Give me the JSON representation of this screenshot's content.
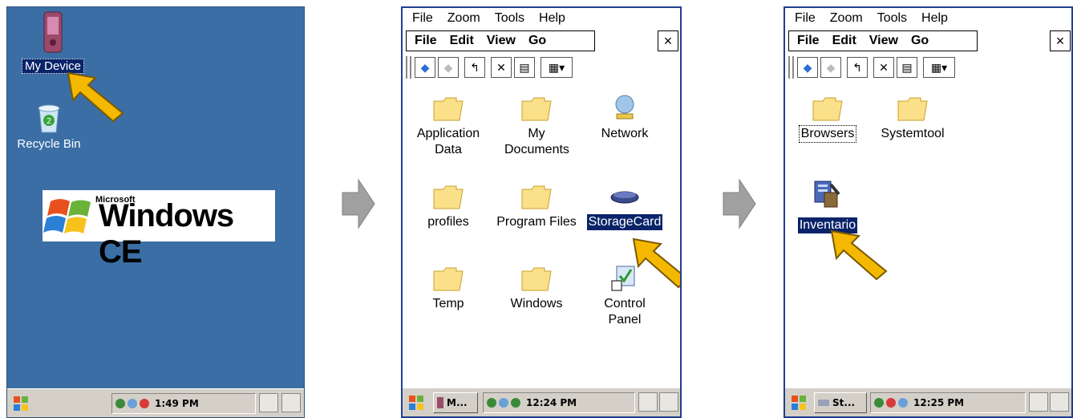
{
  "desktop": {
    "icons": [
      {
        "label": "My Device"
      },
      {
        "label": "Recycle Bin"
      }
    ],
    "logo": {
      "brand": "Microsoft",
      "product": "Windows CE"
    },
    "taskbar": {
      "clock": "1:49 PM"
    }
  },
  "explorer1": {
    "title_menu": [
      "File",
      "Zoom",
      "Tools",
      "Help"
    ],
    "menu": [
      "File",
      "Edit",
      "View",
      "Go"
    ],
    "close": "×",
    "items": [
      {
        "label": "Application Data"
      },
      {
        "label": "My Documents"
      },
      {
        "label": "Network"
      },
      {
        "label": "profiles"
      },
      {
        "label": "Program Files"
      },
      {
        "label": "StorageCard"
      },
      {
        "label": "Temp"
      },
      {
        "label": "Windows"
      },
      {
        "label": "Control Panel"
      }
    ],
    "taskbar": {
      "task": "M...",
      "clock": "12:24 PM"
    }
  },
  "explorer2": {
    "title_menu": [
      "File",
      "Zoom",
      "Tools",
      "Help"
    ],
    "menu": [
      "File",
      "Edit",
      "View",
      "Go"
    ],
    "close": "×",
    "items": [
      {
        "label": "Browsers"
      },
      {
        "label": "Systemtool"
      },
      {
        "label": "Inventario"
      }
    ],
    "taskbar": {
      "task": "St...",
      "clock": "12:25 PM"
    }
  },
  "colors": {
    "desktop": "#3a6ea5",
    "selection": "#0a246a",
    "pointer": "#f5b800",
    "flow_arrow": "#a0a0a0"
  }
}
